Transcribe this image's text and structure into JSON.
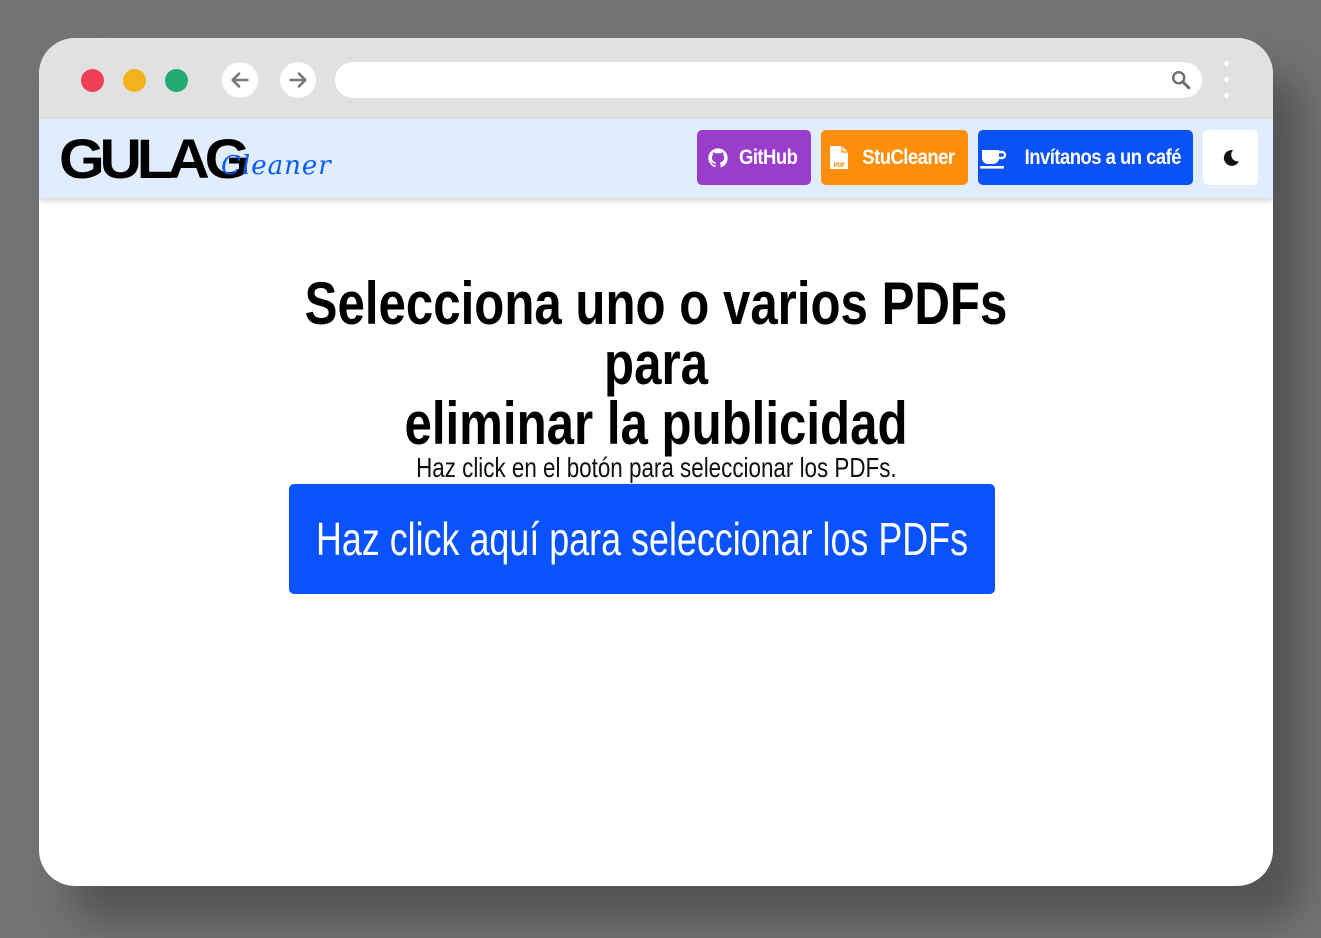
{
  "browser": {
    "back_icon": "arrow-left-icon",
    "forward_icon": "arrow-right-icon",
    "address_value": "",
    "search_icon": "search-icon",
    "menu_icon": "kebab-menu-icon"
  },
  "navbar": {
    "logo_main": "GULAG",
    "logo_sub": "Cleaner",
    "github_label": "GitHub",
    "stucleaner_label": "StuCleaner",
    "cafe_label": "Invítanos a un café",
    "theme_icon": "moon-icon",
    "colors": {
      "github": "#9b3dcb",
      "stucleaner": "#ff8f0a",
      "cafe": "#0a52f5",
      "navbar_bg": "#e1ecfd",
      "logo_sub": "#0a5cf5"
    }
  },
  "main": {
    "headline_line1": "Selecciona uno o varios PDFs para",
    "headline_line2": "eliminar la publicidad",
    "subtitle": "Haz click en el botón para seleccionar los PDFs.",
    "select_button_label": "Haz click aquí para seleccionar los PDFs",
    "select_button_color": "#0a52fb"
  }
}
